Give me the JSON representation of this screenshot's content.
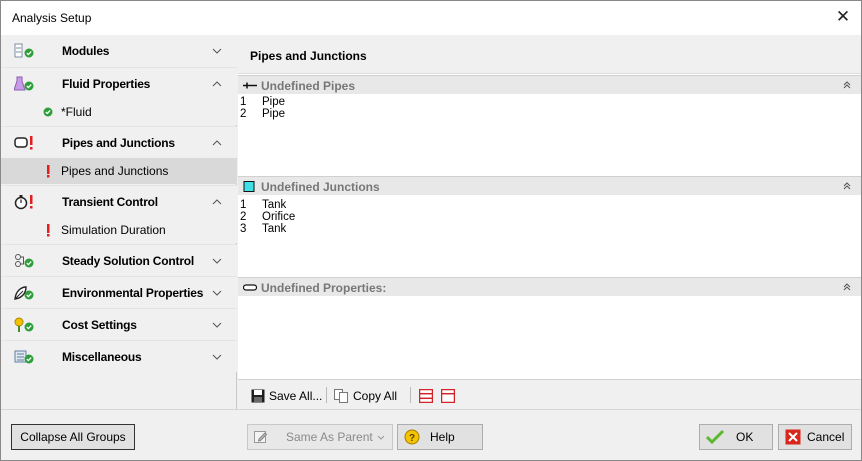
{
  "window": {
    "title": "Analysis Setup",
    "close_glyph": "✕"
  },
  "sidebar": {
    "groups": [
      {
        "label": "Modules",
        "icon": "modules-icon",
        "expanded": false,
        "status": "ok"
      },
      {
        "label": "Fluid Properties",
        "icon": "fluid-flask-icon",
        "expanded": true,
        "status": "ok",
        "items": [
          {
            "label": "*Fluid",
            "status": "ok"
          }
        ]
      },
      {
        "label": "Pipes and Junctions",
        "icon": "pipe-icon",
        "expanded": true,
        "status": "error",
        "items": [
          {
            "label": "Pipes and Junctions",
            "status": "error",
            "selected": true
          }
        ]
      },
      {
        "label": "Transient Control",
        "icon": "stopwatch-icon",
        "expanded": true,
        "status": "error",
        "items": [
          {
            "label": "Simulation Duration",
            "status": "error"
          }
        ]
      },
      {
        "label": "Steady Solution Control",
        "icon": "solver-icon",
        "expanded": false,
        "status": "ok"
      },
      {
        "label": "Environmental Properties",
        "icon": "leaf-icon",
        "expanded": false,
        "status": "ok"
      },
      {
        "label": "Cost Settings",
        "icon": "cost-icon",
        "expanded": false,
        "status": "ok"
      },
      {
        "label": "Miscellaneous",
        "icon": "misc-icon",
        "expanded": false,
        "status": "ok"
      }
    ]
  },
  "content": {
    "title": "Pipes and Junctions",
    "sections": [
      {
        "title": "Undefined Pipes",
        "icon": "pipe-line-icon",
        "rows": [
          {
            "num": "1",
            "name": "Pipe"
          },
          {
            "num": "2",
            "name": "Pipe"
          }
        ]
      },
      {
        "title": "Undefined Junctions",
        "icon": "junction-square-icon",
        "rows": [
          {
            "num": "1",
            "name": "Tank"
          },
          {
            "num": "2",
            "name": "Orifice"
          },
          {
            "num": "3",
            "name": "Tank"
          }
        ]
      },
      {
        "title": "Undefined Properties:",
        "icon": "properties-icon",
        "rows": []
      }
    ],
    "toolbar": {
      "save_all": "Save All...",
      "copy_all": "Copy All"
    }
  },
  "bottom": {
    "collapse_all": "Collapse All Groups",
    "same_as_parent": "Same As Parent",
    "help": "Help",
    "ok": "OK",
    "cancel": "Cancel"
  },
  "colors": {
    "ok_green": "#2e9e3a",
    "error_red": "#e02020",
    "cancel_red": "#d9261c"
  }
}
